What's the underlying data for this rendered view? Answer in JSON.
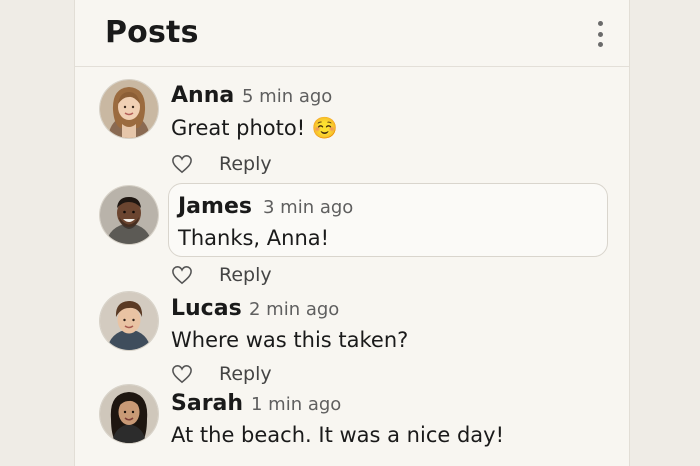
{
  "header": {
    "title": "Posts",
    "menu_icon": "more-vertical-icon"
  },
  "comments": [
    {
      "name": "Anna",
      "time": "5 min ago",
      "text": "Great photo! ☺️",
      "reply_label": "Reply",
      "like_icon": "heart-outline-icon"
    },
    {
      "name": "James",
      "time": "3 min ago",
      "text": "Thanks, Anna!",
      "reply_label": "Reply",
      "like_icon": "heart-outline-icon"
    },
    {
      "name": "Lucas",
      "time": "2 min ago",
      "text": "Where was this taken?",
      "reply_label": "Reply",
      "like_icon": "heart-outline-icon"
    },
    {
      "name": "Sarah",
      "time": "1 min ago",
      "text": "At the beach. It was a nice day!"
    }
  ],
  "colors": {
    "background": "#efece6",
    "panel": "#f8f6f1",
    "text": "#1a1a1a",
    "muted": "#5f5f5f"
  }
}
